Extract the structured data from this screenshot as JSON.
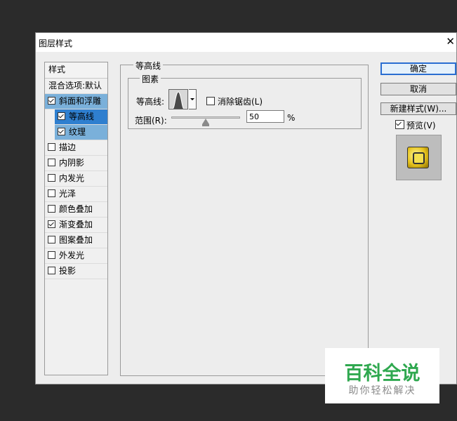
{
  "window": {
    "title": "图层样式"
  },
  "style_list": {
    "header": "样式",
    "blend_options": "混合选项:默认",
    "items": [
      {
        "label": "斜面和浮雕",
        "checked": true
      },
      {
        "label": "等高线",
        "checked": true
      },
      {
        "label": "纹理",
        "checked": true
      },
      {
        "label": "描边",
        "checked": false
      },
      {
        "label": "内阴影",
        "checked": false
      },
      {
        "label": "内发光",
        "checked": false
      },
      {
        "label": "光泽",
        "checked": false
      },
      {
        "label": "颜色叠加",
        "checked": false
      },
      {
        "label": "渐变叠加",
        "checked": true
      },
      {
        "label": "图案叠加",
        "checked": false
      },
      {
        "label": "外发光",
        "checked": false
      },
      {
        "label": "投影",
        "checked": false
      }
    ]
  },
  "panel": {
    "group_title": "等高线",
    "subgroup_title": "图素",
    "contour_label": "等高线:",
    "antialias_label": "消除锯齿(L)",
    "antialias_checked": false,
    "range_label": "范围(R):",
    "range_value": "50",
    "range_unit": "%",
    "range_fraction": 0.5
  },
  "buttons": {
    "ok": "确定",
    "cancel": "取消",
    "new_style": "新建样式(W)..."
  },
  "preview": {
    "label": "预览(V)",
    "checked": true
  },
  "watermark": {
    "title": "百科全说",
    "subtitle": "助你轻松解决"
  }
}
